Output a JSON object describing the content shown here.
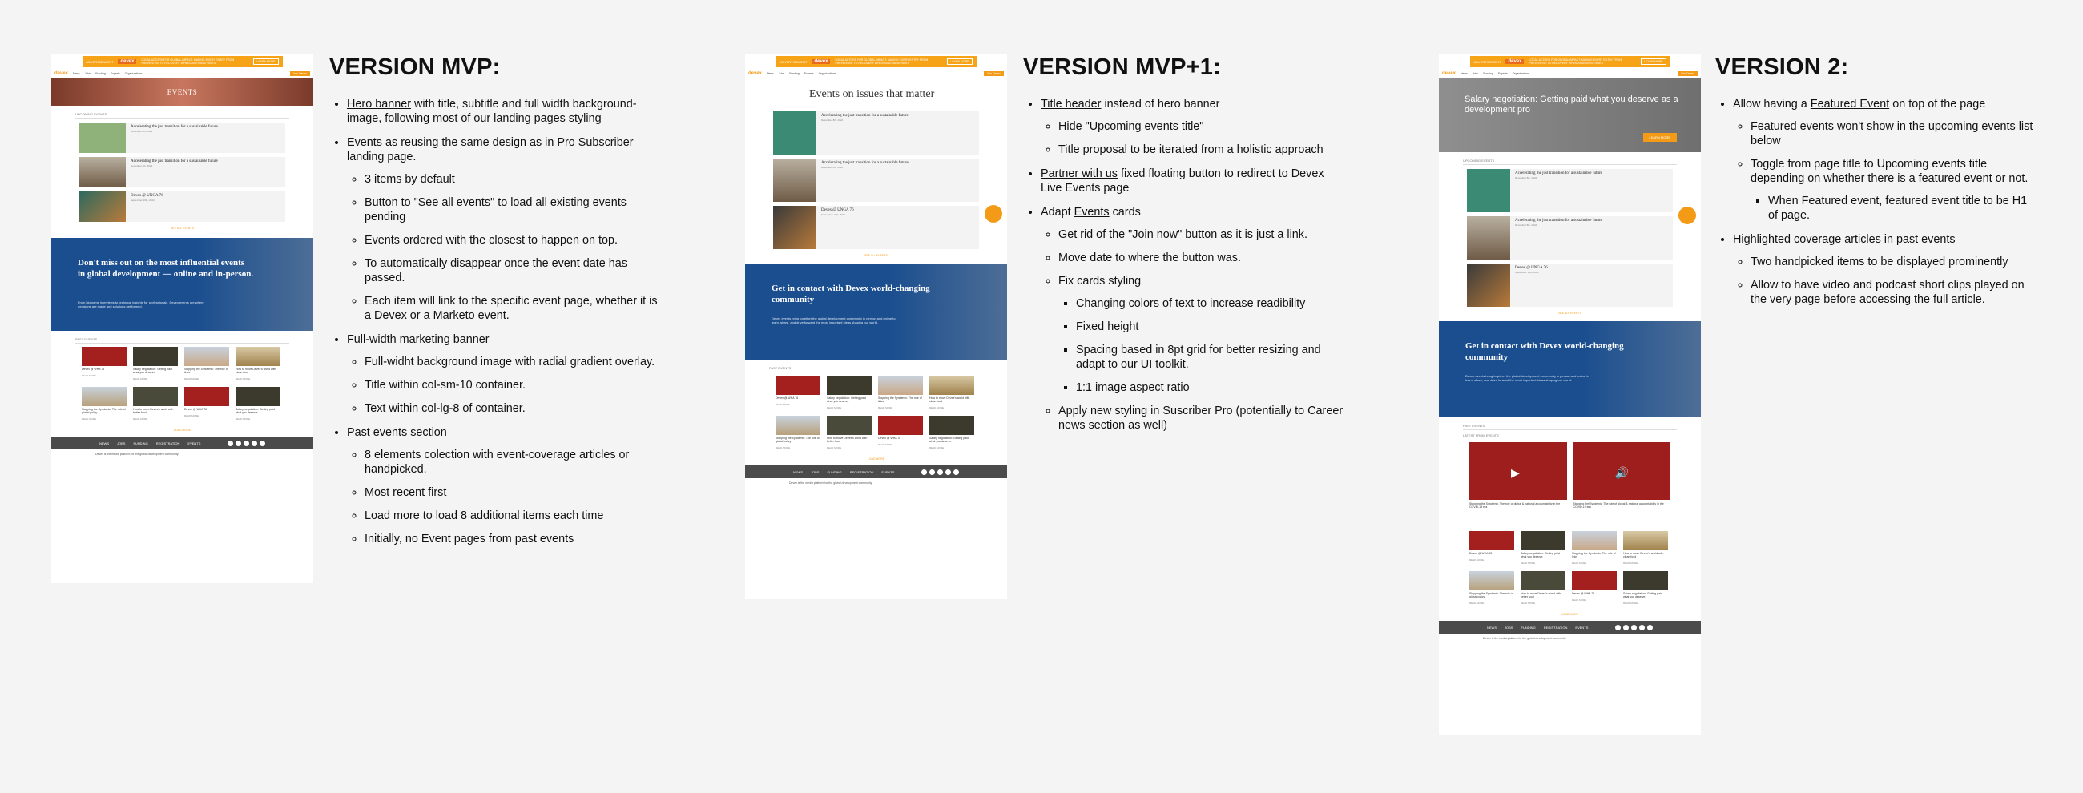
{
  "versions": [
    {
      "title": "VERSION MVP:",
      "hero_text": "EVENTS",
      "bullets": [
        {
          "pre": "",
          "link": "Hero banner",
          "post": " with title, subtitle and full width background-image, following most of our landing pages styling",
          "children": []
        },
        {
          "pre": "",
          "link": "Events",
          "post": " as reusing the same design as in Pro Subscriber landing page.",
          "children": [
            {
              "text": "3 items by default",
              "children": []
            },
            {
              "text": "Button to \"See all events\" to load all existing events pending",
              "children": []
            },
            {
              "text": "Events ordered with the closest to happen on top.",
              "children": []
            },
            {
              "text": "To automatically disappear once the event date has passed.",
              "children": []
            },
            {
              "text": "Each item will link to the specific event page, whether it is a Devex or a Marketo event.",
              "children": []
            }
          ]
        },
        {
          "pre": "Full-width ",
          "link": "marketing banner",
          "post": "",
          "children": [
            {
              "text": "Full-widht background image with radial gradient overlay.",
              "children": []
            },
            {
              "text": "Title within col-sm-10 container.",
              "children": []
            },
            {
              "text": "Text within col-lg-8 of container.",
              "children": []
            }
          ]
        },
        {
          "pre": "",
          "link": "Past events",
          "post": " section",
          "children": [
            {
              "text": "8 elements colection with event-coverage articles or handpicked.",
              "children": []
            },
            {
              "text": "Most recent first",
              "children": []
            },
            {
              "text": "Load more to load 8 additional items each time",
              "children": []
            },
            {
              "text": "Initially, no Event pages from past events",
              "children": []
            }
          ]
        }
      ]
    },
    {
      "title": "VERSION MVP+1:",
      "page_title": "Events on issues that matter",
      "bullets": [
        {
          "pre": "",
          "link": "Title header",
          "post": " instead of hero banner",
          "children": [
            {
              "text": "Hide \"Upcoming events title\"",
              "children": []
            },
            {
              "text": "Title proposal to be iterated from a holistic approach",
              "children": []
            }
          ]
        },
        {
          "pre": "",
          "link": "Partner with us",
          "post": " fixed floating button to redirect to Devex Live Events page",
          "children": []
        },
        {
          "pre": "Adapt ",
          "link": "Events",
          "post": " cards",
          "children": [
            {
              "text": "Get rid of the \"Join now\" button as it is just a link.",
              "children": []
            },
            {
              "text": "Move date to where the button was.",
              "children": []
            },
            {
              "text": "Fix cards styling",
              "children": [
                {
                  "text": "Changing colors of text to increase readibility"
                },
                {
                  "text": "Fixed height"
                },
                {
                  "text": "Spacing based in 8pt grid for better resizing and adapt to our UI toolkit."
                },
                {
                  "text": "1:1 image aspect ratio"
                }
              ]
            },
            {
              "text": "Apply new styling in Suscriber Pro (potentially to Career news section as well)",
              "children": []
            }
          ]
        }
      ]
    },
    {
      "title": "VERSION 2:",
      "featured_title": "Salary negotiation: Getting paid what you deserve as a development pro",
      "bullets": [
        {
          "pre": "Allow having a ",
          "link": "Featured Event",
          "post": " on top of the page",
          "children": [
            {
              "text": "Featured events won't show in the upcoming events list below",
              "children": []
            },
            {
              "text": "Toggle from page title to Upcoming events title depending on whether there is a featured event or not.",
              "children": [
                {
                  "text": "When Featured event, featured event title to be H1 of page."
                }
              ]
            }
          ]
        },
        {
          "pre": "",
          "link": "Highlighted coverage articles",
          "post": " in past events",
          "children": [
            {
              "text": "Two handpicked items to be displayed prominently",
              "children": []
            },
            {
              "text": "Allow to have video and podcast short clips played on the very page before accessing the full article.",
              "children": []
            }
          ]
        }
      ]
    }
  ],
  "mock": {
    "ad_tag": "ADVERTISEMENT",
    "ad_logo": "devex",
    "ad_text": "LOCAL ACTORS FOR GLOBAL IMPACT: MAKING EVERY ENTRY FROM PREVENTIVE TO RECOVERY WHEN ASSESSING RISKS",
    "ad_btn": "LEARN MORE",
    "logo": "devex",
    "nav_items": [
      "News",
      "Jobs",
      "Funding",
      "Experts",
      "Organizations"
    ],
    "nav_join": "Join Devex",
    "upcoming_label": "UPCOMING EVENTS",
    "cards": [
      {
        "title": "Accelerating the just transition for a sustainable future",
        "meta": "December 8th, 2022"
      },
      {
        "title": "Accelerating the just transition for a sustainable future",
        "meta": "December 8th, 2022"
      },
      {
        "title": "Devex @ UNGA 76",
        "meta": "September 10th, 2022"
      }
    ],
    "see_all": "SEE ALL EVENTS",
    "banner_title_a": "Don't miss out on the most influential events in global development — online and in-person.",
    "banner_sub_a": "From big name interviews to technical insights for professionals, Devex events are where decisions are made and solutions get formed.",
    "banner_title_b": "Get in contact with Devex world-changing community",
    "banner_sub_b": "Devex events bring together the global development community in person and online to learn, share, and drive forward the most important ideas shaping our world.",
    "past_label": "PAST EVENTS",
    "past_items": [
      "Devex @ WHA 76",
      "Salary negotiation: Getting paid what you deserve",
      "Stopping the Syndemic: The role of links",
      "How to move Devex's world with clean food",
      "Stopping the Syndemic: The role of global policy",
      "How to move Devex's world with better food",
      "Devex @ WHA 76",
      "Salary negotiation: Getting paid what you deserve"
    ],
    "past_link": "READ MORE",
    "load_more": "LOAD MORE",
    "footer_links": [
      "NEWS",
      "JOBS",
      "FUNDING",
      "REGISTRATION",
      "EVENTS"
    ],
    "footer_text": "Devex is the media platform for the global development community.",
    "featured_btn": "LEARN MORE",
    "highlight_label": "LATEST FROM EVENTS",
    "highlight_items": [
      "Stopping the Syndemic: The role of global & national accountability in the COVID-19 era",
      "Stopping the Syndemic: The role of global & national accountability in the COVID-19 era"
    ]
  }
}
